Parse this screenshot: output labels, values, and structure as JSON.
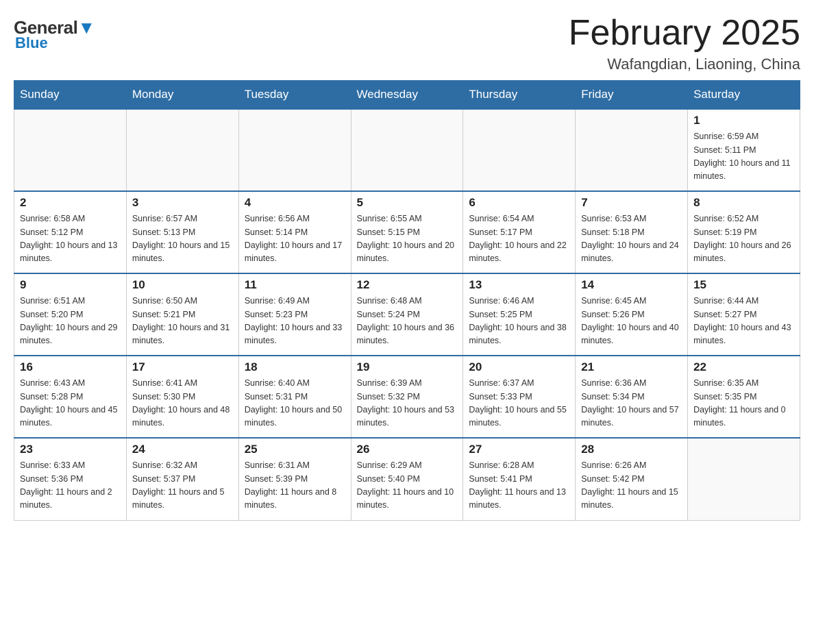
{
  "logo": {
    "general": "General",
    "blue": "Blue"
  },
  "title": {
    "month_year": "February 2025",
    "location": "Wafangdian, Liaoning, China"
  },
  "days_of_week": [
    "Sunday",
    "Monday",
    "Tuesday",
    "Wednesday",
    "Thursday",
    "Friday",
    "Saturday"
  ],
  "weeks": [
    [
      {
        "day": "",
        "info": ""
      },
      {
        "day": "",
        "info": ""
      },
      {
        "day": "",
        "info": ""
      },
      {
        "day": "",
        "info": ""
      },
      {
        "day": "",
        "info": ""
      },
      {
        "day": "",
        "info": ""
      },
      {
        "day": "1",
        "info": "Sunrise: 6:59 AM\nSunset: 5:11 PM\nDaylight: 10 hours and 11 minutes."
      }
    ],
    [
      {
        "day": "2",
        "info": "Sunrise: 6:58 AM\nSunset: 5:12 PM\nDaylight: 10 hours and 13 minutes."
      },
      {
        "day": "3",
        "info": "Sunrise: 6:57 AM\nSunset: 5:13 PM\nDaylight: 10 hours and 15 minutes."
      },
      {
        "day": "4",
        "info": "Sunrise: 6:56 AM\nSunset: 5:14 PM\nDaylight: 10 hours and 17 minutes."
      },
      {
        "day": "5",
        "info": "Sunrise: 6:55 AM\nSunset: 5:15 PM\nDaylight: 10 hours and 20 minutes."
      },
      {
        "day": "6",
        "info": "Sunrise: 6:54 AM\nSunset: 5:17 PM\nDaylight: 10 hours and 22 minutes."
      },
      {
        "day": "7",
        "info": "Sunrise: 6:53 AM\nSunset: 5:18 PM\nDaylight: 10 hours and 24 minutes."
      },
      {
        "day": "8",
        "info": "Sunrise: 6:52 AM\nSunset: 5:19 PM\nDaylight: 10 hours and 26 minutes."
      }
    ],
    [
      {
        "day": "9",
        "info": "Sunrise: 6:51 AM\nSunset: 5:20 PM\nDaylight: 10 hours and 29 minutes."
      },
      {
        "day": "10",
        "info": "Sunrise: 6:50 AM\nSunset: 5:21 PM\nDaylight: 10 hours and 31 minutes."
      },
      {
        "day": "11",
        "info": "Sunrise: 6:49 AM\nSunset: 5:23 PM\nDaylight: 10 hours and 33 minutes."
      },
      {
        "day": "12",
        "info": "Sunrise: 6:48 AM\nSunset: 5:24 PM\nDaylight: 10 hours and 36 minutes."
      },
      {
        "day": "13",
        "info": "Sunrise: 6:46 AM\nSunset: 5:25 PM\nDaylight: 10 hours and 38 minutes."
      },
      {
        "day": "14",
        "info": "Sunrise: 6:45 AM\nSunset: 5:26 PM\nDaylight: 10 hours and 40 minutes."
      },
      {
        "day": "15",
        "info": "Sunrise: 6:44 AM\nSunset: 5:27 PM\nDaylight: 10 hours and 43 minutes."
      }
    ],
    [
      {
        "day": "16",
        "info": "Sunrise: 6:43 AM\nSunset: 5:28 PM\nDaylight: 10 hours and 45 minutes."
      },
      {
        "day": "17",
        "info": "Sunrise: 6:41 AM\nSunset: 5:30 PM\nDaylight: 10 hours and 48 minutes."
      },
      {
        "day": "18",
        "info": "Sunrise: 6:40 AM\nSunset: 5:31 PM\nDaylight: 10 hours and 50 minutes."
      },
      {
        "day": "19",
        "info": "Sunrise: 6:39 AM\nSunset: 5:32 PM\nDaylight: 10 hours and 53 minutes."
      },
      {
        "day": "20",
        "info": "Sunrise: 6:37 AM\nSunset: 5:33 PM\nDaylight: 10 hours and 55 minutes."
      },
      {
        "day": "21",
        "info": "Sunrise: 6:36 AM\nSunset: 5:34 PM\nDaylight: 10 hours and 57 minutes."
      },
      {
        "day": "22",
        "info": "Sunrise: 6:35 AM\nSunset: 5:35 PM\nDaylight: 11 hours and 0 minutes."
      }
    ],
    [
      {
        "day": "23",
        "info": "Sunrise: 6:33 AM\nSunset: 5:36 PM\nDaylight: 11 hours and 2 minutes."
      },
      {
        "day": "24",
        "info": "Sunrise: 6:32 AM\nSunset: 5:37 PM\nDaylight: 11 hours and 5 minutes."
      },
      {
        "day": "25",
        "info": "Sunrise: 6:31 AM\nSunset: 5:39 PM\nDaylight: 11 hours and 8 minutes."
      },
      {
        "day": "26",
        "info": "Sunrise: 6:29 AM\nSunset: 5:40 PM\nDaylight: 11 hours and 10 minutes."
      },
      {
        "day": "27",
        "info": "Sunrise: 6:28 AM\nSunset: 5:41 PM\nDaylight: 11 hours and 13 minutes."
      },
      {
        "day": "28",
        "info": "Sunrise: 6:26 AM\nSunset: 5:42 PM\nDaylight: 11 hours and 15 minutes."
      },
      {
        "day": "",
        "info": ""
      }
    ]
  ]
}
